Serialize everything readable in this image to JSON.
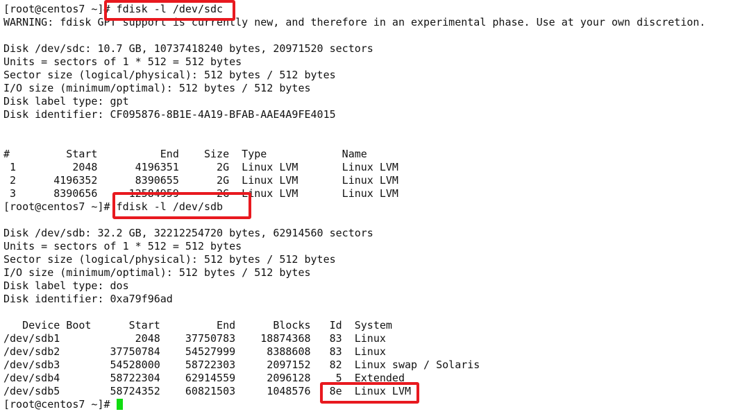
{
  "terminal": {
    "cursor_color": "#11dd11",
    "highlight_color": "#e8191f",
    "lines": [
      "[root@centos7 ~]# fdisk -l /dev/sdc",
      "WARNING: fdisk GPT support is currently new, and therefore in an experimental phase. Use at your own discretion.",
      "",
      "Disk /dev/sdc: 10.7 GB, 10737418240 bytes, 20971520 sectors",
      "Units = sectors of 1 * 512 = 512 bytes",
      "Sector size (logical/physical): 512 bytes / 512 bytes",
      "I/O size (minimum/optimal): 512 bytes / 512 bytes",
      "Disk label type: gpt",
      "Disk identifier: CF095876-8B1E-4A19-BFAB-AAE4A9FE4015",
      "",
      "",
      "#         Start          End    Size  Type            Name",
      " 1         2048      4196351      2G  Linux LVM       Linux LVM",
      " 2      4196352      8390655      2G  Linux LVM       Linux LVM",
      " 3      8390656     12584959      2G  Linux LVM       Linux LVM",
      "[root@centos7 ~]# fdisk -l /dev/sdb",
      "",
      "Disk /dev/sdb: 32.2 GB, 32212254720 bytes, 62914560 sectors",
      "Units = sectors of 1 * 512 = 512 bytes",
      "Sector size (logical/physical): 512 bytes / 512 bytes",
      "I/O size (minimum/optimal): 512 bytes / 512 bytes",
      "Disk label type: dos",
      "Disk identifier: 0xa79f96ad",
      "",
      "   Device Boot      Start         End      Blocks   Id  System",
      "/dev/sdb1            2048    37750783    18874368   83  Linux",
      "/dev/sdb2        37750784    54527999     8388608   83  Linux",
      "/dev/sdb3        54528000    58722303     2097152   82  Linux swap / Solaris",
      "/dev/sdb4        58722304    62914559     2096128    5  Extended",
      "/dev/sdb5        58724352    60821503     1048576   8e  Linux LVM",
      "[root@centos7 ~]# "
    ]
  }
}
